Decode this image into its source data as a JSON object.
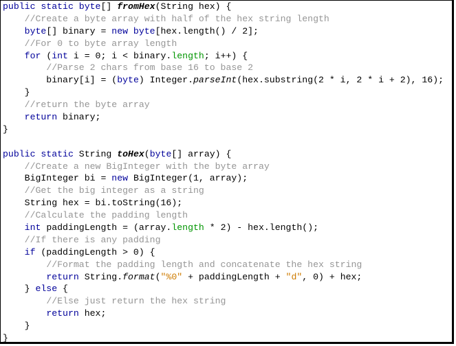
{
  "colors": {
    "keyword": "#00009a",
    "comment": "#959595",
    "field": "#009500",
    "string": "#ce7b00",
    "text": "#000000",
    "background": "#ffffff"
  },
  "code_lines": [
    [
      {
        "t": "public static byte",
        "c": "kw"
      },
      {
        "t": "[] "
      },
      {
        "t": "fromHex",
        "c": "bit"
      },
      {
        "t": "("
      },
      {
        "t": "String hex) {"
      }
    ],
    [
      {
        "t": "    "
      },
      {
        "t": "//Create a byte array with half of the hex string length",
        "c": "cm"
      }
    ],
    [
      {
        "t": "    "
      },
      {
        "t": "byte",
        "c": "kw"
      },
      {
        "t": "[] binary = "
      },
      {
        "t": "new byte",
        "c": "kw"
      },
      {
        "t": "[hex.length() / 2];"
      }
    ],
    [
      {
        "t": "    "
      },
      {
        "t": "//For 0 to byte array length",
        "c": "cm"
      }
    ],
    [
      {
        "t": "    "
      },
      {
        "t": "for",
        "c": "kw"
      },
      {
        "t": " ("
      },
      {
        "t": "int",
        "c": "kw"
      },
      {
        "t": " i = 0; i < binary."
      },
      {
        "t": "length",
        "c": "fld"
      },
      {
        "t": "; i++) {"
      }
    ],
    [
      {
        "t": "        "
      },
      {
        "t": "//Parse 2 chars from base 16 to base 2",
        "c": "cm"
      }
    ],
    [
      {
        "t": "        binary[i] = ("
      },
      {
        "t": "byte",
        "c": "kw"
      },
      {
        "t": ") Integer."
      },
      {
        "t": "parseInt",
        "c": "it"
      },
      {
        "t": "(hex.substring(2 * i, 2 * i + 2), 16);"
      }
    ],
    [
      {
        "t": "    }"
      }
    ],
    [
      {
        "t": "    "
      },
      {
        "t": "//return the byte array",
        "c": "cm"
      }
    ],
    [
      {
        "t": "    "
      },
      {
        "t": "return",
        "c": "kw"
      },
      {
        "t": " binary;"
      }
    ],
    [
      {
        "t": "}"
      }
    ],
    [
      {
        "t": ""
      }
    ],
    [
      {
        "t": "public static",
        "c": "kw"
      },
      {
        "t": " String "
      },
      {
        "t": "toHex",
        "c": "bit"
      },
      {
        "t": "("
      },
      {
        "t": "byte",
        "c": "kw"
      },
      {
        "t": "[] array) {"
      }
    ],
    [
      {
        "t": "    "
      },
      {
        "t": "//Create a new BigInteger with the byte array",
        "c": "cm"
      }
    ],
    [
      {
        "t": "    BigInteger bi = "
      },
      {
        "t": "new",
        "c": "kw"
      },
      {
        "t": " BigInteger(1, array);"
      }
    ],
    [
      {
        "t": "    "
      },
      {
        "t": "//Get the big integer as a string",
        "c": "cm"
      }
    ],
    [
      {
        "t": "    String hex = bi.toString(16);"
      }
    ],
    [
      {
        "t": "    "
      },
      {
        "t": "//Calculate the padding length",
        "c": "cm"
      }
    ],
    [
      {
        "t": "    "
      },
      {
        "t": "int",
        "c": "kw"
      },
      {
        "t": " paddingLength = (array."
      },
      {
        "t": "length",
        "c": "fld"
      },
      {
        "t": " * 2) - hex.length();"
      }
    ],
    [
      {
        "t": "    "
      },
      {
        "t": "//If there is any padding",
        "c": "cm"
      }
    ],
    [
      {
        "t": "    "
      },
      {
        "t": "if",
        "c": "kw"
      },
      {
        "t": " (paddingLength > 0) {"
      }
    ],
    [
      {
        "t": "        "
      },
      {
        "t": "//Format the padding length and concatenate the hex string",
        "c": "cm"
      }
    ],
    [
      {
        "t": "        "
      },
      {
        "t": "return",
        "c": "kw"
      },
      {
        "t": " String."
      },
      {
        "t": "format",
        "c": "it"
      },
      {
        "t": "("
      },
      {
        "t": "\"%0\"",
        "c": "str"
      },
      {
        "t": " + paddingLength + "
      },
      {
        "t": "\"d\"",
        "c": "str"
      },
      {
        "t": ", 0) + hex;"
      }
    ],
    [
      {
        "t": "    } "
      },
      {
        "t": "else",
        "c": "kw"
      },
      {
        "t": " {"
      }
    ],
    [
      {
        "t": "        "
      },
      {
        "t": "//Else just return the hex string",
        "c": "cm"
      }
    ],
    [
      {
        "t": "        "
      },
      {
        "t": "return",
        "c": "kw"
      },
      {
        "t": " hex;"
      }
    ],
    [
      {
        "t": "    }"
      }
    ],
    [
      {
        "t": "}"
      }
    ]
  ]
}
